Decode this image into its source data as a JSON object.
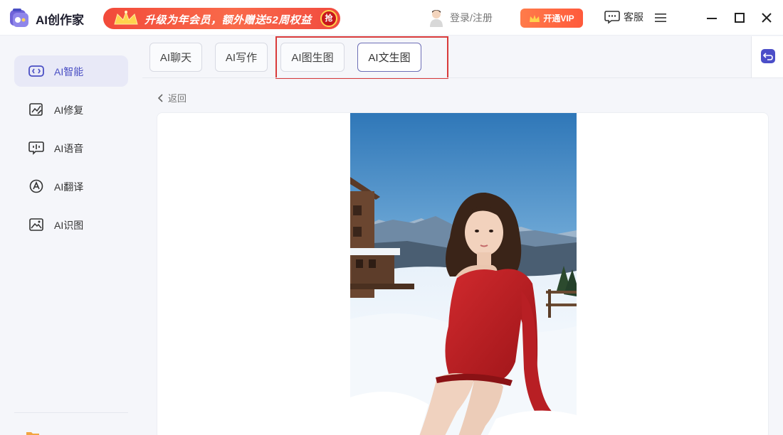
{
  "app": {
    "title": "AI创作家"
  },
  "promo": {
    "text": "升级为年会员，额外赠送52周权益",
    "badge": "抢"
  },
  "header": {
    "login_label": "登录/注册",
    "vip_label": "开通VIP",
    "service_label": "客服"
  },
  "sidebar": {
    "items": [
      {
        "label": "AI智能",
        "icon": "ai-chip-icon",
        "active": true
      },
      {
        "label": "AI修复",
        "icon": "image-repair-icon",
        "active": false
      },
      {
        "label": "AI语音",
        "icon": "voice-icon",
        "active": false
      },
      {
        "label": "AI翻译",
        "icon": "translate-icon",
        "active": false
      },
      {
        "label": "AI识图",
        "icon": "image-recognize-icon",
        "active": false
      }
    ]
  },
  "tabs": [
    {
      "label": "AI聊天"
    },
    {
      "label": "AI写作"
    },
    {
      "label": "AI图生图"
    },
    {
      "label": "AI文生图",
      "selected": true
    }
  ],
  "main": {
    "back_label": "返回"
  },
  "colors": {
    "accent": "#4b4ec8",
    "promo": "#f24a3a",
    "vip": "#ff6a3d",
    "highlight_box": "#d93a3a"
  }
}
